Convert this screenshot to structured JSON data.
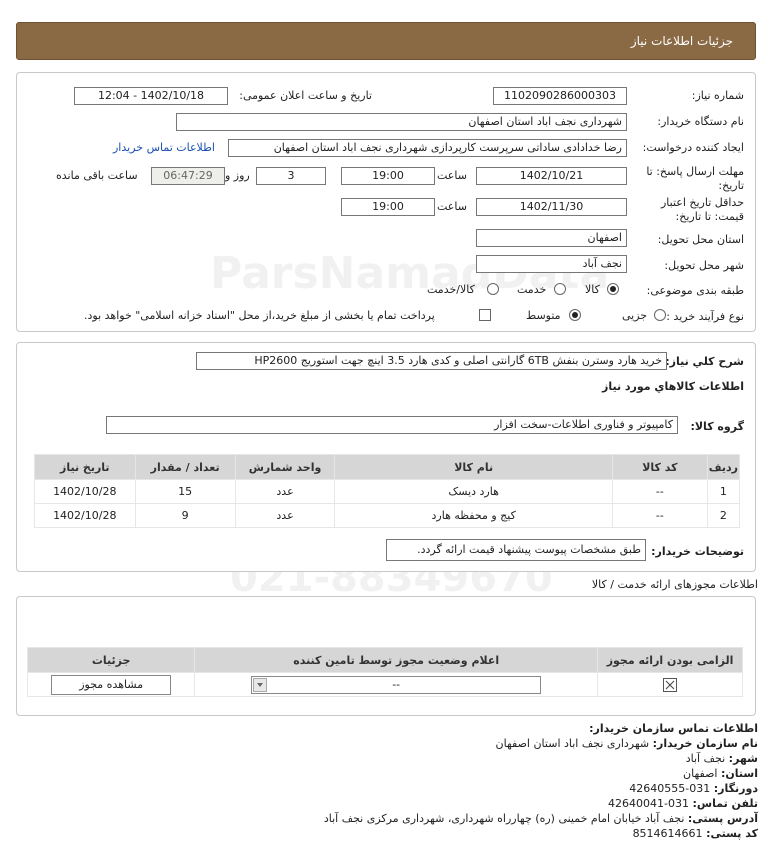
{
  "header": {
    "title": "جزئیات اطلاعات نیاز"
  },
  "info": {
    "need_number_label": "شماره نیاز:",
    "need_number": "1102090286000303",
    "announce_label": "تاریخ و ساعت اعلان عمومی:",
    "announce_value": "1402/10/18 - 12:04",
    "buyer_org_label": "نام دستگاه خریدار:",
    "buyer_org": "شهرداری نجف اباد استان اصفهان",
    "creator_label": "ایجاد کننده درخواست:",
    "creator": "رضا خدادادی ساداتی سرپرست  کارپردازی شهرداری نجف اباد استان اصفهان",
    "contact_link": "اطلاعات تماس خریدار",
    "reply_deadline_label": "مهلت ارسال پاسخ: تا تاریخ:",
    "reply_date": "1402/10/21",
    "time_label": "ساعت",
    "reply_time": "19:00",
    "days_value": "3",
    "days_label": "روز و",
    "remaining_time": "06:47:29",
    "remaining_label": "ساعت باقی مانده",
    "validity_label": "حداقل تاریخ اعتبار قیمت: تا تاریخ:",
    "validity_date": "1402/11/30",
    "validity_time": "19:00",
    "province_label": "استان محل تحویل:",
    "province": "اصفهان",
    "city_label": "شهر محل تحویل:",
    "city": "نجف آباد",
    "category_label": "طبقه بندی موضوعی:",
    "category_options": [
      "کالا",
      "خدمت",
      "کالا/خدمت"
    ],
    "category_selected": "کالا",
    "process_label": "نوع فرآیند خرید :",
    "process_options": [
      "جزیی",
      "متوسط"
    ],
    "process_selected": "متوسط",
    "payment_note": "پرداخت تمام یا بخشی از مبلغ خرید،از محل \"اسناد خزانه اسلامی\" خواهد بود."
  },
  "need": {
    "summary_label": "شرح کلي نياز:",
    "summary": "خرید هارد وسترن بنفش 6TB گارانتی اصلی و کدی هارد 3.5 اینچ جهت استوریج HP2600",
    "goods_heading": "اطلاعات کالاهاي مورد نياز",
    "group_label": "گروه کالا:",
    "group_value": "کامپیوتر و فناوری اطلاعات-سخت افزار",
    "table_headers": [
      "ردیف",
      "کد کالا",
      "نام کالا",
      "واحد شمارش",
      "تعداد / مقدار",
      "تاریخ نیاز"
    ],
    "rows": [
      [
        "1",
        "--",
        "هارد دیسک",
        "عدد",
        "15",
        "1402/10/28"
      ],
      [
        "2",
        "--",
        "کیج و محفظه هارد",
        "عدد",
        "9",
        "1402/10/28"
      ]
    ],
    "buyer_notes_label": "توضیحات خریدار:",
    "buyer_notes": "طبق مشخصات پیوست پیشنهاد قیمت ارائه گردد."
  },
  "licenses": {
    "title": "اطلاعات مجوزهای ارائه خدمت / کالا",
    "headers": [
      "الزامی بودن ارائه مجوز",
      "اعلام وضعیت مجوز توسط تامین کننده",
      "جزئیات"
    ],
    "select_value": "--",
    "view_button": "مشاهده مجوز"
  },
  "contact": {
    "title": "اطلاعات تماس سازمان خریدار:",
    "org_label": "نام سازمان خریدار:",
    "org": "شهرداری نجف اباد استان اصفهان",
    "city_label": "شهر:",
    "city": "نجف آباد",
    "province_label": "استان:",
    "province": "اصفهان",
    "fax_label": "دورنگار:",
    "fax": "031-42640555",
    "phone_label": "تلفن تماس:",
    "phone": "031-42640041",
    "address_label": "آدرس پستی:",
    "address": "نجف آباد خیابان امام خمینی (ره) چهارراه شهرداری، شهرداری مرکزی نجف آباد",
    "postal_label": "کد پستی:",
    "postal": "8514614661"
  }
}
